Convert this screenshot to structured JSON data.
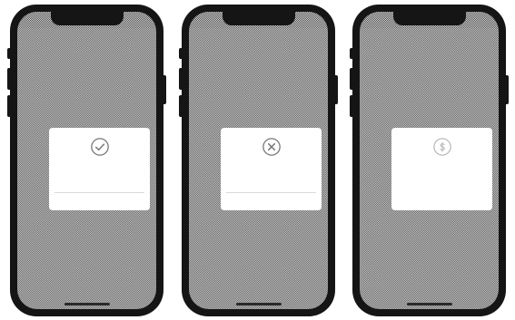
{
  "phones": [
    {
      "nav_title": "",
      "dialog": {
        "icon": "check-circle-icon",
        "title": "",
        "message": "",
        "button_label": ""
      },
      "footer_text": ""
    },
    {
      "nav_title": "",
      "dialog": {
        "icon": "error-circle-icon",
        "title": "",
        "message": "",
        "button_label": ""
      },
      "footer_text": ""
    },
    {
      "nav_title": "",
      "dialog": {
        "icon": "currency-circle-icon",
        "title": "",
        "message": "",
        "button_label": ""
      },
      "footer_text": ""
    }
  ],
  "colors": {
    "device_frame": "#151515",
    "screen_light": "#bdbdbd",
    "screen_dark": "#6f6f6f",
    "dialog_background": "#ffffff",
    "dialog_title": "#4a4a4a",
    "dialog_muted_text": "#888888",
    "icon_stroke": "#777777",
    "icon_stroke_faint": "#bbbbbb"
  }
}
